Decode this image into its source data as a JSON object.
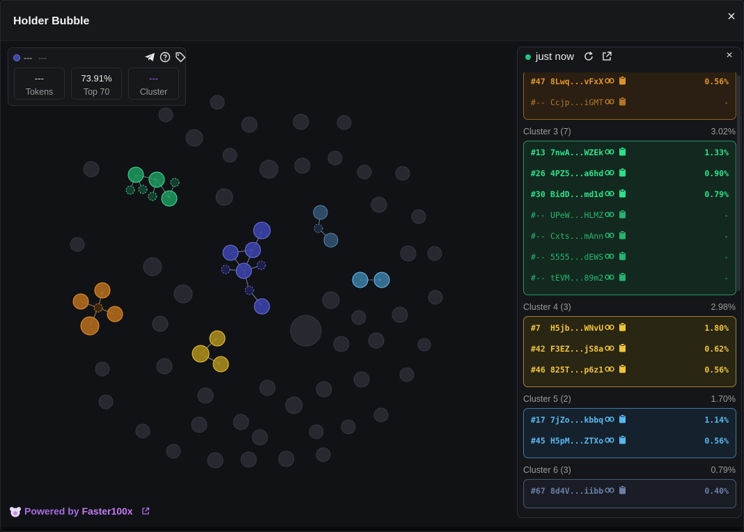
{
  "header": {
    "title": "Holder Bubble",
    "close_label": "×"
  },
  "stats": {
    "name": "---",
    "sub": "---",
    "boxes": [
      {
        "value": "---",
        "label": "Tokens"
      },
      {
        "value": "73.91%",
        "label": "Top 70"
      },
      {
        "value": "---",
        "label": "Cluster"
      }
    ],
    "icons": [
      "telegram-icon",
      "help-icon",
      "tag-icon"
    ]
  },
  "footer": {
    "powered_prefix": "Powered by ",
    "brand": "Faster100x"
  },
  "panel": {
    "status": "just now",
    "close_label": "×",
    "clusters": [
      {
        "label": "",
        "pct": "",
        "color": "#e0932d",
        "rows": [
          {
            "rank": "#47",
            "addr": "8Lwq...vFxX",
            "pct": "0.56%"
          },
          {
            "rank": "#--",
            "addr": "Ccjp...iGMT",
            "pct": "-"
          }
        ]
      },
      {
        "label": "Cluster 3 (7)",
        "pct": "3.02%",
        "color": "#2ee08a",
        "rows": [
          {
            "rank": "#13",
            "addr": "7nwA...WZEk",
            "pct": "1.33%"
          },
          {
            "rank": "#26",
            "addr": "4PZ5...a6hd",
            "pct": "0.90%"
          },
          {
            "rank": "#30",
            "addr": "BidD...md1d",
            "pct": "0.79%"
          },
          {
            "rank": "#--",
            "addr": "UPeW...HLMZ",
            "pct": "-"
          },
          {
            "rank": "#--",
            "addr": "Cxts...mAnn",
            "pct": "-"
          },
          {
            "rank": "#--",
            "addr": "5555...dEWS",
            "pct": "-"
          },
          {
            "rank": "#--",
            "addr": "tEVM...89m2",
            "pct": "-"
          }
        ]
      },
      {
        "label": "Cluster 4 (3)",
        "pct": "2.98%",
        "color": "#f0c43c",
        "rows": [
          {
            "rank": "#7",
            "addr": "H5jb...WNvU",
            "pct": "1.80%"
          },
          {
            "rank": "#42",
            "addr": "F3EZ...jS8a",
            "pct": "0.62%"
          },
          {
            "rank": "#46",
            "addr": "825T...p6z1",
            "pct": "0.56%"
          }
        ]
      },
      {
        "label": "Cluster 5 (2)",
        "pct": "1.70%",
        "color": "#5ab8ef",
        "rows": [
          {
            "rank": "#17",
            "addr": "7jZo...kbbq",
            "pct": "1.14%"
          },
          {
            "rank": "#45",
            "addr": "H5pM...ZTXo",
            "pct": "0.56%"
          }
        ]
      },
      {
        "label": "Cluster 6 (3)",
        "pct": "0.79%",
        "color": "#6b7fa8",
        "rows": [
          {
            "rank": "#67",
            "addr": "8d4V...iibb",
            "pct": "0.40%"
          }
        ]
      }
    ]
  }
}
